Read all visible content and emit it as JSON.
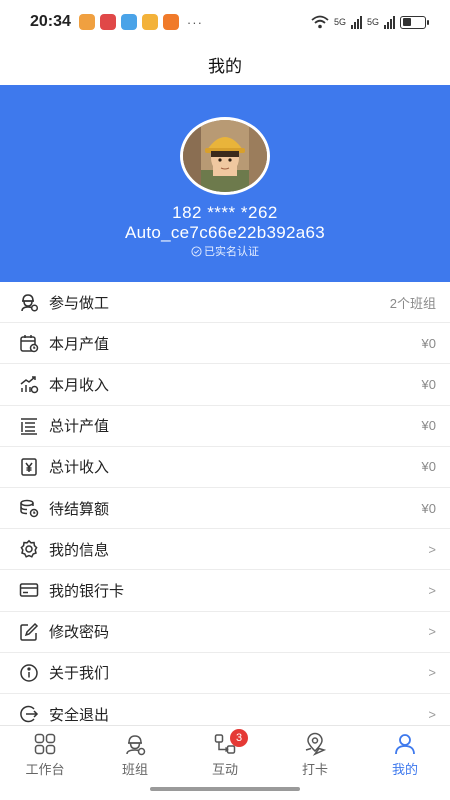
{
  "status_bar": {
    "time": "20:34",
    "more": "···",
    "net1": "5G",
    "net2": "5G",
    "app_colors": [
      "#f0a040",
      "#e04848",
      "#4aa3e8",
      "#f3b23a",
      "#f07a2a"
    ]
  },
  "header": {
    "title": "我的"
  },
  "profile": {
    "phone": "182 **** *262",
    "account": "Auto_ce7c66e22b392a63",
    "verified_label": "已实名认证",
    "bg_color": "#3e79ed"
  },
  "menu": [
    {
      "label": "参与做工",
      "value": "2个班组",
      "icon": "worker-icon"
    },
    {
      "label": "本月产值",
      "value": "¥0",
      "icon": "calendar-icon"
    },
    {
      "label": "本月收入",
      "value": "¥0",
      "icon": "income-chart-icon"
    },
    {
      "label": "总计产值",
      "value": "¥0",
      "icon": "list-total-icon"
    },
    {
      "label": "总计收入",
      "value": "¥0",
      "icon": "yen-book-icon"
    },
    {
      "label": "待结算额",
      "value": "¥0",
      "icon": "coins-clock-icon"
    },
    {
      "label": "我的信息",
      "value": ">",
      "icon": "gear-icon"
    },
    {
      "label": "我的银行卡",
      "value": ">",
      "icon": "bank-card-icon"
    },
    {
      "label": "修改密码",
      "value": ">",
      "icon": "edit-icon"
    },
    {
      "label": "关于我们",
      "value": ">",
      "icon": "info-icon"
    },
    {
      "label": "安全退出",
      "value": ">",
      "icon": "logout-icon"
    }
  ],
  "bottom_nav": [
    {
      "label": "工作台",
      "icon": "grid-icon"
    },
    {
      "label": "班组",
      "icon": "team-icon"
    },
    {
      "label": "互动",
      "icon": "interaction-icon",
      "badge": "3"
    },
    {
      "label": "打卡",
      "icon": "location-icon"
    },
    {
      "label": "我的",
      "icon": "profile-icon",
      "active": true
    }
  ]
}
